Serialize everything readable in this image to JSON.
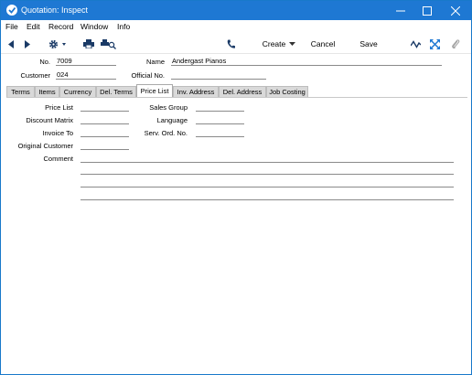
{
  "window": {
    "title": "Quotation: Inspect"
  },
  "menu": {
    "items": [
      "File",
      "Edit",
      "Record",
      "Window",
      "Info"
    ]
  },
  "toolbar": {
    "create_label": "Create",
    "cancel_label": "Cancel",
    "save_label": "Save"
  },
  "header": {
    "no_label": "No.",
    "no_value": "7009",
    "name_label": "Name",
    "name_value": "Andergast Pianos",
    "customer_label": "Customer",
    "customer_value": "024",
    "official_label": "Official No.",
    "official_value": ""
  },
  "tabs": [
    {
      "label": "Terms"
    },
    {
      "label": "Items"
    },
    {
      "label": "Currency"
    },
    {
      "label": "Del. Terms"
    },
    {
      "label": "Price List"
    },
    {
      "label": "Inv. Address"
    },
    {
      "label": "Del. Address"
    },
    {
      "label": "Job Costing"
    }
  ],
  "active_tab": "Price List",
  "form": {
    "price_list_label": "Price List",
    "price_list_value": "",
    "discount_matrix_label": "Discount Matrix",
    "discount_matrix_value": "",
    "invoice_to_label": "Invoice To",
    "invoice_to_value": "",
    "original_customer_label": "Original Customer",
    "original_customer_value": "",
    "comment_label": "Comment",
    "comment_value": "",
    "sales_group_label": "Sales Group",
    "sales_group_value": "",
    "language_label": "Language",
    "language_value": "",
    "serv_ord_label": "Serv. Ord. No.",
    "serv_ord_value": ""
  }
}
